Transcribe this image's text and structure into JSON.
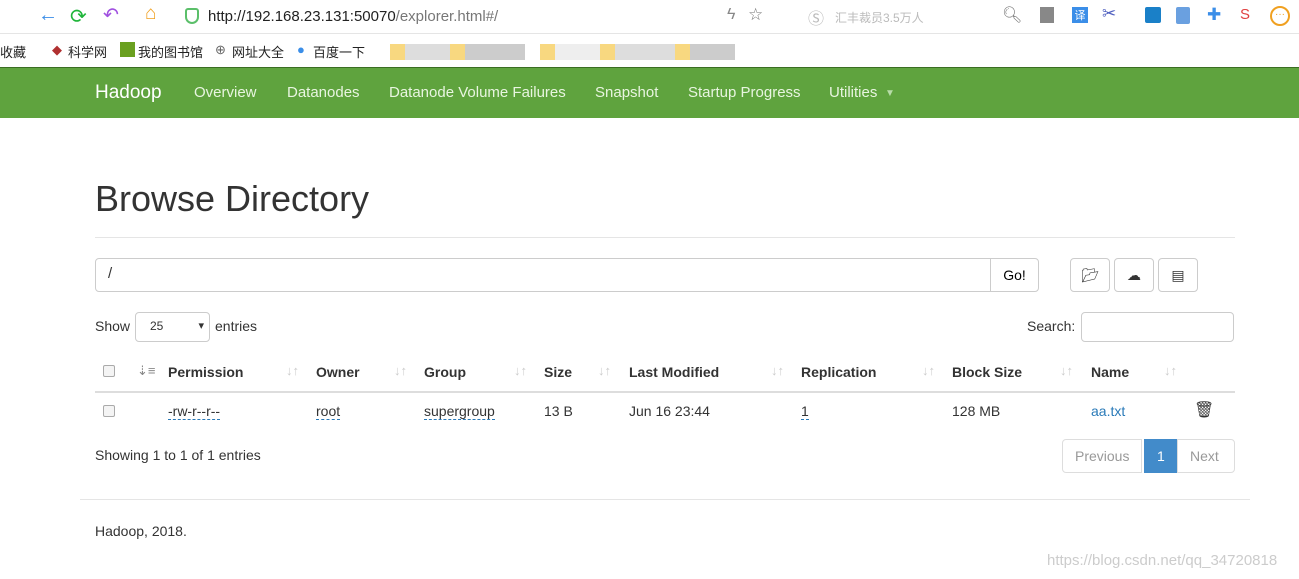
{
  "browser": {
    "url_host": "http://192.168.23.131:50070",
    "url_path": "/explorer.html#/",
    "search_hint": "汇丰裁员3.5万人",
    "bookmarks": [
      "收藏",
      "科学网",
      "我的图书馆",
      "网址大全",
      "百度一下"
    ]
  },
  "nav": {
    "brand": "Hadoop",
    "items": [
      "Overview",
      "Datanodes",
      "Datanode Volume Failures",
      "Snapshot",
      "Startup Progress",
      "Utilities"
    ]
  },
  "page": {
    "title": "Browse Directory",
    "path": "/",
    "go": "Go!",
    "show": "Show",
    "entries_value": "25",
    "entries": "entries",
    "search": "Search:"
  },
  "table": {
    "headers": [
      "Permission",
      "Owner",
      "Group",
      "Size",
      "Last Modified",
      "Replication",
      "Block Size",
      "Name"
    ],
    "rows": [
      {
        "permission": "-rw-r--r--",
        "owner": "root",
        "group": "supergroup",
        "size": "13 B",
        "modified": "Jun 16 23:44",
        "replication": "1",
        "block_size": "128 MB",
        "name": "aa.txt"
      }
    ]
  },
  "info": "Showing 1 to 1 of 1 entries",
  "pagination": {
    "prev": "Previous",
    "page": "1",
    "next": "Next"
  },
  "footer": "Hadoop, 2018.",
  "watermark": "https://blog.csdn.net/qq_34720818",
  "colors": {
    "navbar": "#5fa33e",
    "link": "#2a7ab8",
    "active_page": "#428bca"
  }
}
